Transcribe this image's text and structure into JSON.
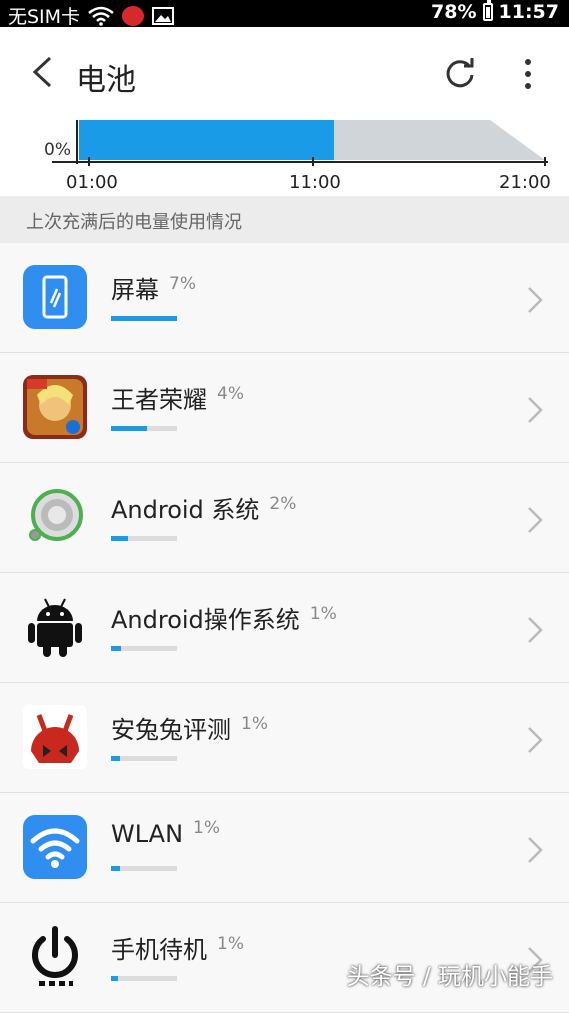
{
  "status": {
    "carrier": "无SIM卡",
    "battery_percent": "78%",
    "battery_level": 0.78,
    "time": "11:57"
  },
  "header": {
    "title": "电池"
  },
  "chart": {
    "zero_label": "0%",
    "ticks": [
      "01:00",
      "11:00",
      "21:00"
    ],
    "used_color": "#1a9be8",
    "estimate_color": "#d0d5da"
  },
  "section_label": "上次充满后的电量使用情况",
  "apps": [
    {
      "name": "屏幕",
      "percent": "7%",
      "value": 1.0,
      "icon": "screen-icon"
    },
    {
      "name": "王者荣耀",
      "percent": "4%",
      "value": 0.55,
      "icon": "game-icon"
    },
    {
      "name": "Android 系统",
      "percent": "2%",
      "value": 0.25,
      "icon": "android-system-icon"
    },
    {
      "name": "Android操作系统",
      "percent": "1%",
      "value": 0.15,
      "icon": "android-os-icon"
    },
    {
      "name": "安兔兔评测",
      "percent": "1%",
      "value": 0.13,
      "icon": "antutu-icon"
    },
    {
      "name": "WLAN",
      "percent": "1%",
      "value": 0.13,
      "icon": "wlan-icon"
    },
    {
      "name": "手机待机",
      "percent": "1%",
      "value": 0.1,
      "icon": "standby-icon"
    }
  ],
  "watermark": "头条号 / 玩机小能手"
}
